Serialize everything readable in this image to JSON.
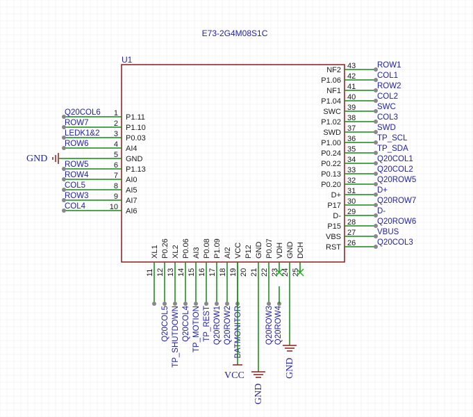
{
  "component": {
    "title": "E73-2G4M08S1C",
    "ref": "U1"
  },
  "colors": {
    "grid": "#e9e9e9",
    "body": "#8b1a1a",
    "pin_text": "#1a1a1a",
    "wire": "#118811",
    "net": "#2222aa",
    "dot": "#888888",
    "noconnect": "#22aa22"
  },
  "left_pins": [
    {
      "num": "1",
      "name": "P1.11",
      "net": "Q20COL6"
    },
    {
      "num": "2",
      "name": "P1.10",
      "net": "ROW7"
    },
    {
      "num": "3",
      "name": "P0.03",
      "net": "LEDK1&2"
    },
    {
      "num": "4",
      "name": "AI4",
      "net": "ROW6"
    },
    {
      "num": "5",
      "name": "GND",
      "net": ""
    },
    {
      "num": "6",
      "name": "P1.13",
      "net": "ROW5"
    },
    {
      "num": "7",
      "name": "AI0",
      "net": "ROW4"
    },
    {
      "num": "8",
      "name": "AI5",
      "net": "COL5"
    },
    {
      "num": "9",
      "name": "AI7",
      "net": "ROW3"
    },
    {
      "num": "10",
      "name": "AI6",
      "net": "COL4"
    }
  ],
  "right_pins": [
    {
      "num": "43",
      "name": "NF2",
      "net": "ROW1"
    },
    {
      "num": "42",
      "name": "P1.06",
      "net": "COL1"
    },
    {
      "num": "41",
      "name": "NF1",
      "net": "ROW2"
    },
    {
      "num": "40",
      "name": "P1.04",
      "net": "COL2"
    },
    {
      "num": "39",
      "name": "SWC",
      "net": "SWC"
    },
    {
      "num": "38",
      "name": "P1.02",
      "net": "COL3"
    },
    {
      "num": "37",
      "name": "SWD",
      "net": "SWD"
    },
    {
      "num": "36",
      "name": "P1.00",
      "net": "TP_SCL"
    },
    {
      "num": "35",
      "name": "P0.24",
      "net": "TP_SDA"
    },
    {
      "num": "34",
      "name": "P0.22",
      "net": "Q20COL1"
    },
    {
      "num": "33",
      "name": "P0.13",
      "net": "Q20COL2"
    },
    {
      "num": "32",
      "name": "P0.20",
      "net": "Q20ROW5"
    },
    {
      "num": "31",
      "name": "D+",
      "net": "D+"
    },
    {
      "num": "30",
      "name": "P17",
      "net": "Q20ROW7"
    },
    {
      "num": "29",
      "name": "D-",
      "net": "D-"
    },
    {
      "num": "28",
      "name": "P15",
      "net": "Q20ROW6"
    },
    {
      "num": "27",
      "name": "VBS",
      "net": "VBUS"
    },
    {
      "num": "26",
      "name": "RST",
      "net": "Q20COL3"
    }
  ],
  "bottom_pins": [
    {
      "num": "11",
      "name": "XL1",
      "net": ""
    },
    {
      "num": "12",
      "name": "P0.26",
      "net": "Q20COL5"
    },
    {
      "num": "13",
      "name": "XL2",
      "net": "TP_SHUTDOWN"
    },
    {
      "num": "14",
      "name": "P0.06",
      "net": "Q20COL4"
    },
    {
      "num": "15",
      "name": "AI3",
      "net": "TP_MOTION"
    },
    {
      "num": "16",
      "name": "P0.08",
      "net": "TP_REST"
    },
    {
      "num": "17",
      "name": "P1.09",
      "net": "Q20ROW1"
    },
    {
      "num": "18",
      "name": "AI2",
      "net": "Q20ROW2"
    },
    {
      "num": "19",
      "name": "VCC",
      "net": "BATMONITOR"
    },
    {
      "num": "20",
      "name": "P12",
      "net": ""
    },
    {
      "num": "21",
      "name": "GND",
      "net": ""
    },
    {
      "num": "22",
      "name": "P0.07",
      "net": "Q20ROW3"
    },
    {
      "num": "23",
      "name": "VDH",
      "net": ""
    },
    {
      "num": "24",
      "name": "GND",
      "net": "Q20ROW4"
    },
    {
      "num": "25",
      "name": "DCH",
      "net": ""
    }
  ],
  "power": {
    "gnd_left": "GND",
    "vcc": "VCC",
    "gnd_bottom1": "GND",
    "gnd_bottom2": "GND"
  }
}
